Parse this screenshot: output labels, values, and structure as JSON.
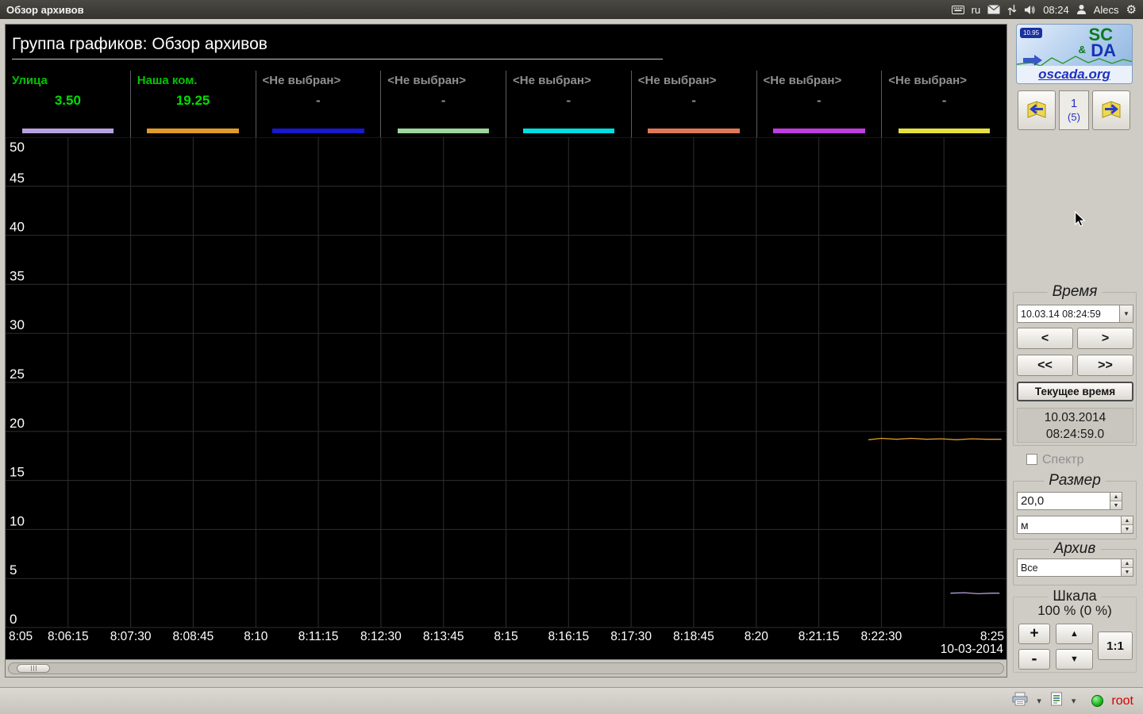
{
  "topbar": {
    "title": "Обзор архивов",
    "lang": "ru",
    "clock": "08:24",
    "user": "Alecs"
  },
  "window": {
    "title": "Группа графиков: Обзор архивов"
  },
  "legend": [
    {
      "name": "Улица",
      "value": "3.50",
      "color": "#b8a0e0",
      "active": true
    },
    {
      "name": "Наша ком.",
      "value": "19.25",
      "color": "#e09b28",
      "active": true
    },
    {
      "name": "<Не выбран>",
      "value": "-",
      "color": "#1818cc",
      "active": false
    },
    {
      "name": "<Не выбран>",
      "value": "-",
      "color": "#9cd69c",
      "active": false
    },
    {
      "name": "<Не выбран>",
      "value": "-",
      "color": "#00dede",
      "active": false
    },
    {
      "name": "<Не выбран>",
      "value": "-",
      "color": "#e07858",
      "active": false
    },
    {
      "name": "<Не выбран>",
      "value": "-",
      "color": "#c03ce0",
      "active": false
    },
    {
      "name": "<Не выбран>",
      "value": "-",
      "color": "#e4e040",
      "active": false
    }
  ],
  "chart_data": {
    "type": "line",
    "title": "Группа графиков: Обзор архивов",
    "ylim": [
      0,
      50
    ],
    "y_ticks": [
      0,
      5,
      10,
      15,
      20,
      25,
      30,
      35,
      40,
      45,
      50
    ],
    "x_ticks": [
      "8:05",
      "8:06:15",
      "8:07:30",
      "8:08:45",
      "8:10",
      "8:11:15",
      "8:12:30",
      "8:13:45",
      "8:15",
      "8:16:15",
      "8:17:30",
      "8:18:45",
      "8:20",
      "8:21:15",
      "8:22:30",
      "8:25"
    ],
    "x_intervals": 16,
    "date_label": "10-03-2014",
    "grid": true,
    "background": "#000000",
    "series": [
      {
        "name": "Улица",
        "color": "#b8a0e0",
        "current": 3.5,
        "points": [
          [
            0.944,
            3.5
          ],
          [
            0.958,
            3.55
          ],
          [
            0.972,
            3.45
          ],
          [
            0.985,
            3.5
          ],
          [
            0.993,
            3.5
          ]
        ]
      },
      {
        "name": "Наша ком.",
        "color": "#e09b28",
        "current": 19.25,
        "points": [
          [
            0.862,
            19.15
          ],
          [
            0.875,
            19.3
          ],
          [
            0.89,
            19.2
          ],
          [
            0.905,
            19.3
          ],
          [
            0.92,
            19.2
          ],
          [
            0.935,
            19.25
          ],
          [
            0.95,
            19.15
          ],
          [
            0.965,
            19.25
          ],
          [
            0.98,
            19.2
          ],
          [
            0.995,
            19.2
          ]
        ]
      }
    ]
  },
  "logo": {
    "ver": "10.95",
    "sc": "SC",
    "amp": "&",
    "da": "DA",
    "site": "oscada.org"
  },
  "pager": {
    "page": "1",
    "of": "(5)"
  },
  "time_group": {
    "title": "Время",
    "combo": "10.03.14 08:24:59",
    "step_back": "<",
    "step_fwd": ">",
    "jump_back": "<<",
    "jump_fwd": ">>",
    "current_time": "Текущее время",
    "date": "10.03.2014",
    "time": "08:24:59.0"
  },
  "spectrum": {
    "label": "Спектр",
    "checked": false
  },
  "size_group": {
    "title": "Размер",
    "value": "20,0",
    "unit": "м"
  },
  "archive_group": {
    "title": "Архив",
    "value": "Все"
  },
  "scale_group": {
    "title": "Шкала",
    "value": "100 % (0 %)",
    "zoom_in": "+",
    "zoom_out": "-",
    "one_one": "1:1"
  },
  "statusbar": {
    "user": "root"
  },
  "icons": {
    "dropdown": "▼",
    "up": "▲",
    "down": "▼",
    "chevron": "▾"
  }
}
